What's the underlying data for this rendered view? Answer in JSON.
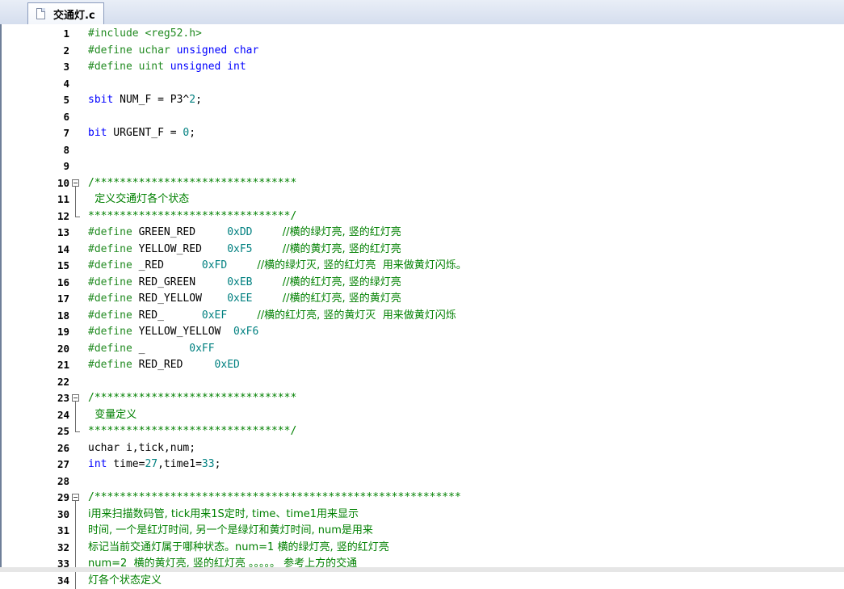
{
  "tab": {
    "filename": "交通灯.c",
    "icon": "document-icon"
  },
  "lines": [
    {
      "n": "1",
      "fold": "",
      "segs": [
        {
          "c": "pre",
          "t": "#include <reg52.h>"
        }
      ]
    },
    {
      "n": "2",
      "fold": "",
      "segs": [
        {
          "c": "pre",
          "t": "#define uchar "
        },
        {
          "c": "kw",
          "t": "unsigned char"
        }
      ]
    },
    {
      "n": "3",
      "fold": "",
      "segs": [
        {
          "c": "pre",
          "t": "#define uint "
        },
        {
          "c": "kw",
          "t": "unsigned int"
        }
      ]
    },
    {
      "n": "4",
      "fold": "",
      "segs": []
    },
    {
      "n": "5",
      "fold": "",
      "segs": [
        {
          "c": "kw",
          "t": "sbit"
        },
        {
          "c": "plain",
          "t": " NUM_F = P3^"
        },
        {
          "c": "num",
          "t": "2"
        },
        {
          "c": "plain",
          "t": ";"
        }
      ]
    },
    {
      "n": "6",
      "fold": "",
      "segs": []
    },
    {
      "n": "7",
      "fold": "",
      "segs": [
        {
          "c": "kw",
          "t": "bit"
        },
        {
          "c": "plain",
          "t": " URGENT_F = "
        },
        {
          "c": "num",
          "t": "0"
        },
        {
          "c": "plain",
          "t": ";"
        }
      ]
    },
    {
      "n": "8",
      "fold": "",
      "segs": []
    },
    {
      "n": "9",
      "fold": "",
      "segs": []
    },
    {
      "n": "10",
      "fold": "start",
      "segs": [
        {
          "c": "cmt",
          "t": "/********************************"
        }
      ]
    },
    {
      "n": "11",
      "fold": "mid",
      "segs": [
        {
          "c": "cmt",
          "t": "  定义交通灯各个状态"
        }
      ]
    },
    {
      "n": "12",
      "fold": "end",
      "segs": [
        {
          "c": "cmt",
          "t": "********************************/"
        }
      ]
    },
    {
      "n": "13",
      "fold": "",
      "segs": [
        {
          "c": "pre",
          "t": "#define "
        },
        {
          "c": "plain",
          "t": "GREEN_RED     "
        },
        {
          "c": "num",
          "t": "0xDD"
        },
        {
          "c": "cmt",
          "t": "         //横的绿灯亮, 竖的红灯亮"
        }
      ]
    },
    {
      "n": "14",
      "fold": "",
      "segs": [
        {
          "c": "pre",
          "t": "#define "
        },
        {
          "c": "plain",
          "t": "YELLOW_RED    "
        },
        {
          "c": "num",
          "t": "0xF5"
        },
        {
          "c": "cmt",
          "t": "         //横的黄灯亮, 竖的红灯亮"
        }
      ]
    },
    {
      "n": "15",
      "fold": "",
      "segs": [
        {
          "c": "pre",
          "t": "#define "
        },
        {
          "c": "plain",
          "t": "_RED      "
        },
        {
          "c": "num",
          "t": "0xFD"
        },
        {
          "c": "cmt",
          "t": "         //横的绿灯灭, 竖的红灯亮  用来做黄灯闪烁。"
        }
      ]
    },
    {
      "n": "16",
      "fold": "",
      "segs": [
        {
          "c": "pre",
          "t": "#define "
        },
        {
          "c": "plain",
          "t": "RED_GREEN     "
        },
        {
          "c": "num",
          "t": "0xEB"
        },
        {
          "c": "cmt",
          "t": "         //横的红灯亮, 竖的绿灯亮"
        }
      ]
    },
    {
      "n": "17",
      "fold": "",
      "segs": [
        {
          "c": "pre",
          "t": "#define "
        },
        {
          "c": "plain",
          "t": "RED_YELLOW    "
        },
        {
          "c": "num",
          "t": "0xEE"
        },
        {
          "c": "cmt",
          "t": "         //横的红灯亮, 竖的黄灯亮"
        }
      ]
    },
    {
      "n": "18",
      "fold": "",
      "segs": [
        {
          "c": "pre",
          "t": "#define "
        },
        {
          "c": "plain",
          "t": "RED_      "
        },
        {
          "c": "num",
          "t": "0xEF"
        },
        {
          "c": "cmt",
          "t": "         //横的红灯亮, 竖的黄灯灭  用来做黄灯闪烁"
        }
      ]
    },
    {
      "n": "19",
      "fold": "",
      "segs": [
        {
          "c": "pre",
          "t": "#define "
        },
        {
          "c": "plain",
          "t": "YELLOW_YELLOW  "
        },
        {
          "c": "num",
          "t": "0xF6"
        }
      ]
    },
    {
      "n": "20",
      "fold": "",
      "segs": [
        {
          "c": "pre",
          "t": "#define "
        },
        {
          "c": "plain",
          "t": "_       "
        },
        {
          "c": "num",
          "t": "0xFF"
        }
      ]
    },
    {
      "n": "21",
      "fold": "",
      "segs": [
        {
          "c": "pre",
          "t": "#define "
        },
        {
          "c": "plain",
          "t": "RED_RED     "
        },
        {
          "c": "num",
          "t": "0xED"
        }
      ]
    },
    {
      "n": "22",
      "fold": "",
      "segs": []
    },
    {
      "n": "23",
      "fold": "start",
      "segs": [
        {
          "c": "cmt",
          "t": "/********************************"
        }
      ]
    },
    {
      "n": "24",
      "fold": "mid",
      "segs": [
        {
          "c": "cmt",
          "t": "  变量定义"
        }
      ]
    },
    {
      "n": "25",
      "fold": "end",
      "segs": [
        {
          "c": "cmt",
          "t": "********************************/"
        }
      ]
    },
    {
      "n": "26",
      "fold": "",
      "segs": [
        {
          "c": "plain",
          "t": "uchar i,tick,num;"
        }
      ]
    },
    {
      "n": "27",
      "fold": "",
      "segs": [
        {
          "c": "kw",
          "t": "int"
        },
        {
          "c": "plain",
          "t": " time="
        },
        {
          "c": "num",
          "t": "27"
        },
        {
          "c": "plain",
          "t": ",time1="
        },
        {
          "c": "num",
          "t": "33"
        },
        {
          "c": "plain",
          "t": ";"
        }
      ]
    },
    {
      "n": "28",
      "fold": "",
      "segs": []
    },
    {
      "n": "29",
      "fold": "start",
      "segs": [
        {
          "c": "cmt",
          "t": "/**********************************************************"
        }
      ]
    },
    {
      "n": "30",
      "fold": "mid",
      "segs": [
        {
          "c": "cmt",
          "t": "i用来扫描数码管, tick用来1S定时, time、time1用来显示"
        }
      ]
    },
    {
      "n": "31",
      "fold": "mid",
      "segs": [
        {
          "c": "cmt",
          "t": "时间, 一个是红灯时间, 另一个是绿灯和黄灯时间, num是用来"
        }
      ]
    },
    {
      "n": "32",
      "fold": "mid",
      "segs": [
        {
          "c": "cmt",
          "t": "标记当前交通灯属于哪种状态。num=1 横的绿灯亮, 竖的红灯亮"
        }
      ]
    },
    {
      "n": "33",
      "fold": "mid",
      "segs": [
        {
          "c": "cmt",
          "t": "num=2  横的黄灯亮, 竖的红灯亮 。。。。。 参考上方的交通"
        }
      ]
    },
    {
      "n": "34",
      "fold": "mid",
      "segs": [
        {
          "c": "cmt",
          "t": "灯各个状态定义"
        }
      ]
    }
  ]
}
